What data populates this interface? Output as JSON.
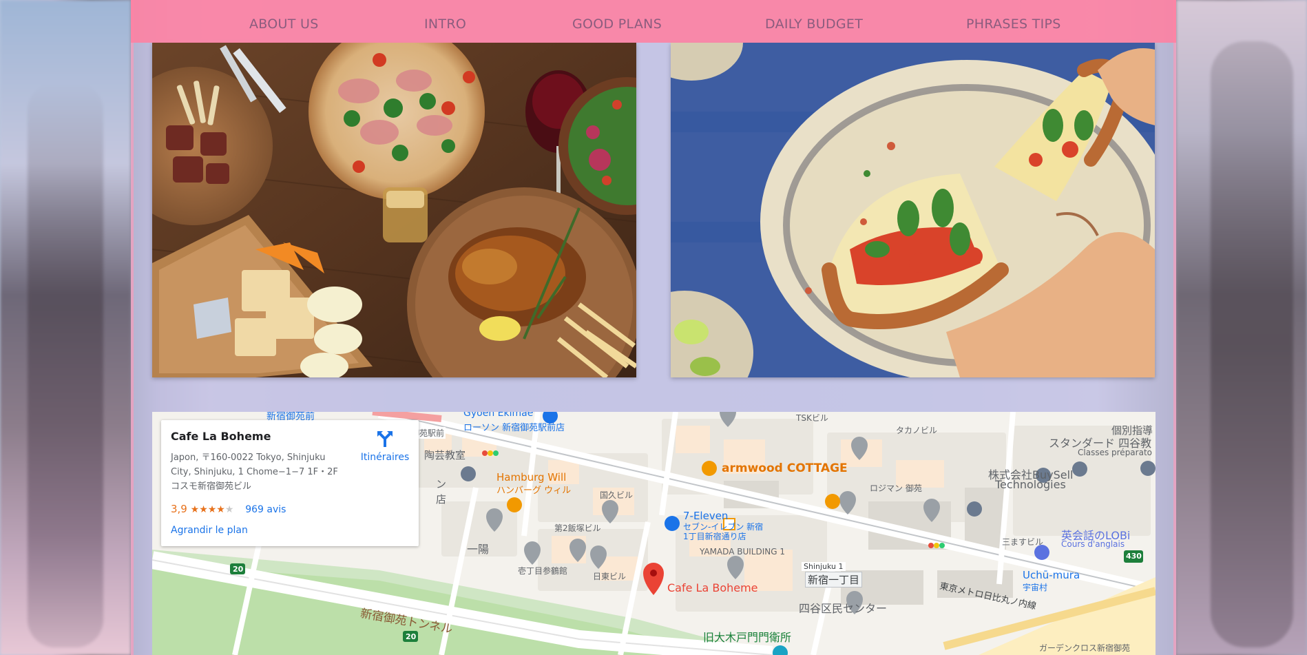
{
  "nav": {
    "items": [
      {
        "label": "ABOUT US"
      },
      {
        "label": "INTRO"
      },
      {
        "label": "GOOD PLANS"
      },
      {
        "label": "DAILY BUDGET"
      },
      {
        "label": "PHRASES TIPS"
      }
    ]
  },
  "colors": {
    "navbar": "#ff80a0",
    "nav_text": "#8b5c7e",
    "page_overlay": "#c4c6e8",
    "link_blue": "#1a73e8",
    "rating_orange": "#e7711b",
    "map_pin_red": "#ea4335"
  },
  "photos": {
    "left": {
      "icon": "food-table-photo"
    },
    "right": {
      "icon": "anime-pizza-photo"
    }
  },
  "map_card": {
    "title": "Cafe La Boheme",
    "address": "Japon, 〒160-0022 Tokyo, Shinjuku City, Shinjuku, 1 Chome−1−7 1F・2F コスモ新宿御苑ビル",
    "directions_label": "Itinéraires",
    "rating_value": "3,9",
    "rating_stars": 4,
    "reviews": "969 avis",
    "enlarge_label": "Agrandir le plan"
  },
  "map_labels": {
    "shinjuku_gyoen_station": "新宿御苑前",
    "shinjuku_gyoen_station_small": "新宿御苑駅前",
    "gyoen_ekimae": "Gyoen Ekimae",
    "lawson": "ローソン 新宿御苑駅前店",
    "tsk": "TSKビル",
    "takanobiru": "タカノビル",
    "kobetsu": "個別指導",
    "standard": "スタンダード 四谷教",
    "classes": "Classes préparato",
    "engei": "陶芸教室",
    "armwood": "armwood COTTAGE",
    "buysell": "株式会社BuySell",
    "buysell_en": "Technologies",
    "hamburg": "Hamburg Will",
    "hamburg_jp": "ハンバーグ ウィル",
    "kokukyu": "国久ビル",
    "rojiman": "ロジマン 御苑",
    "seven": "7-Eleven",
    "seven_jp": "セブン-イレブン 新宿",
    "seven_jp2": "1丁目新宿通り店",
    "daini": "第2飯塚ビル",
    "yamada": "YAMADA BUILDING 1",
    "eikaiwa": "英会話のLOBi",
    "eikaiwa_fr": "Cours d'anglais",
    "mitsuwa": "三ますビル",
    "ichiyo": "一陽",
    "ikecho": "壱丁目参鶴館",
    "nitto": "日東ビル",
    "cafe": "Cafe La Boheme",
    "shinjuku1": "Shinjuku 1",
    "shinjuku1_jp": "新宿一丁目",
    "tokyo_metro": "東京メトロ日比丸ノ内線",
    "uchumura": "Uchū-mura",
    "uchumura_jp": "宇宙村",
    "yotsuya": "四谷区民センター",
    "tunnel": "新宿御苑トンネル",
    "okido": "旧大木戸門門衛所",
    "garden_cross": "ガーデンクロス新宿御苑",
    "route20a": "20",
    "route20b": "20",
    "route430": "430",
    "inside": "ン",
    "inside2": "店",
    "bldg1": "新"
  }
}
